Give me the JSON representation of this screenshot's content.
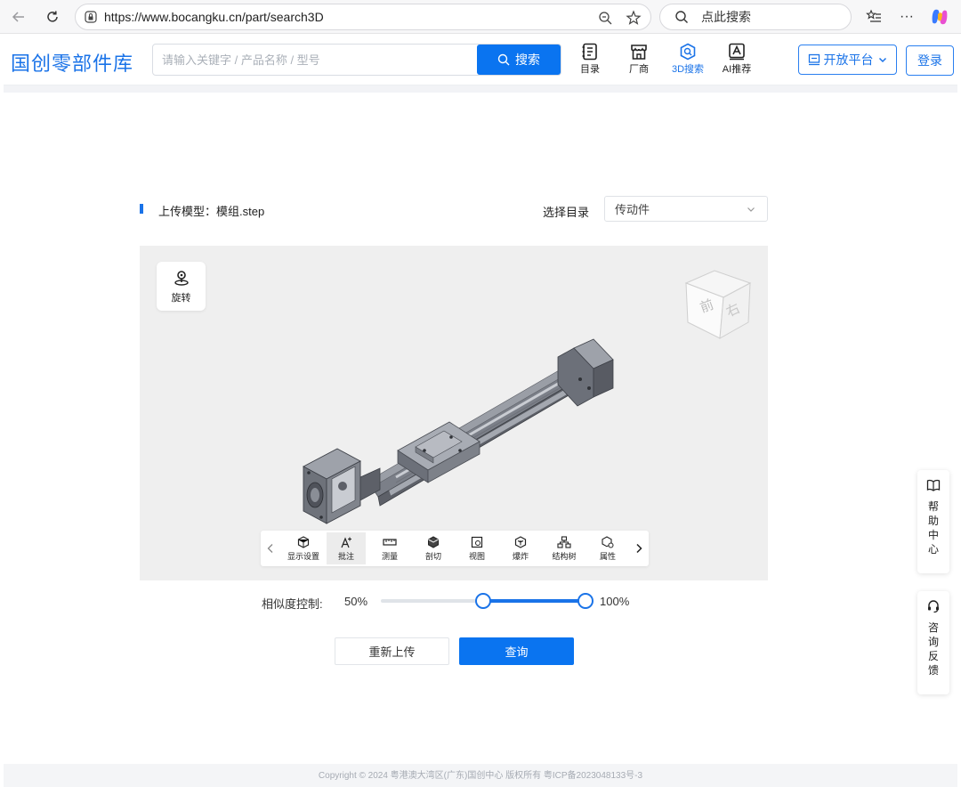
{
  "browser": {
    "url": "https://www.bocangku.cn/part/search3D",
    "search_placeholder": "点此搜索"
  },
  "header": {
    "logo": "国创零部件库",
    "search_placeholder": "请输入关键字 / 产品名称 / 型号",
    "search_button": "搜索",
    "nav": [
      {
        "label": "目录",
        "icon": "catalog-icon"
      },
      {
        "label": "厂商",
        "icon": "shop-icon"
      },
      {
        "label": "3D搜索",
        "icon": "3d-search-icon",
        "active": true
      },
      {
        "label": "AI推荐",
        "icon": "ai-recommend-icon"
      }
    ],
    "open_platform": "开放平台",
    "login": "登录"
  },
  "upload": {
    "title": "上传模型：模组.step",
    "category_label": "选择目录",
    "category_value": "传动件"
  },
  "viewer": {
    "rotate_label": "旋转",
    "viewcube_faces": [
      "前",
      "右"
    ],
    "tools": [
      {
        "label": "显示设置",
        "icon": "display-settings-icon"
      },
      {
        "label": "批注",
        "icon": "annotate-icon",
        "selected": true
      },
      {
        "label": "测量",
        "icon": "measure-icon"
      },
      {
        "label": "剖切",
        "icon": "section-icon"
      },
      {
        "label": "视图",
        "icon": "view-icon"
      },
      {
        "label": "爆炸",
        "icon": "explode-icon"
      },
      {
        "label": "结构树",
        "icon": "structure-tree-icon"
      },
      {
        "label": "属性",
        "icon": "properties-icon"
      }
    ]
  },
  "similarity": {
    "label": "相似度控制:",
    "min_label": "50%",
    "max_label": "100%",
    "range_low": 0.5,
    "range_high": 1.0
  },
  "actions": {
    "reupload": "重新上传",
    "query": "查询"
  },
  "side": {
    "help": "帮助中心",
    "feedback": "咨询反馈"
  },
  "footer": {
    "text": "Copyright © 2024 粤港澳大湾区(广东)国创中心 版权所有    粤ICP备2023048133号-3"
  },
  "colors": {
    "accent": "#0a74f0",
    "brand": "#1a73e8"
  }
}
